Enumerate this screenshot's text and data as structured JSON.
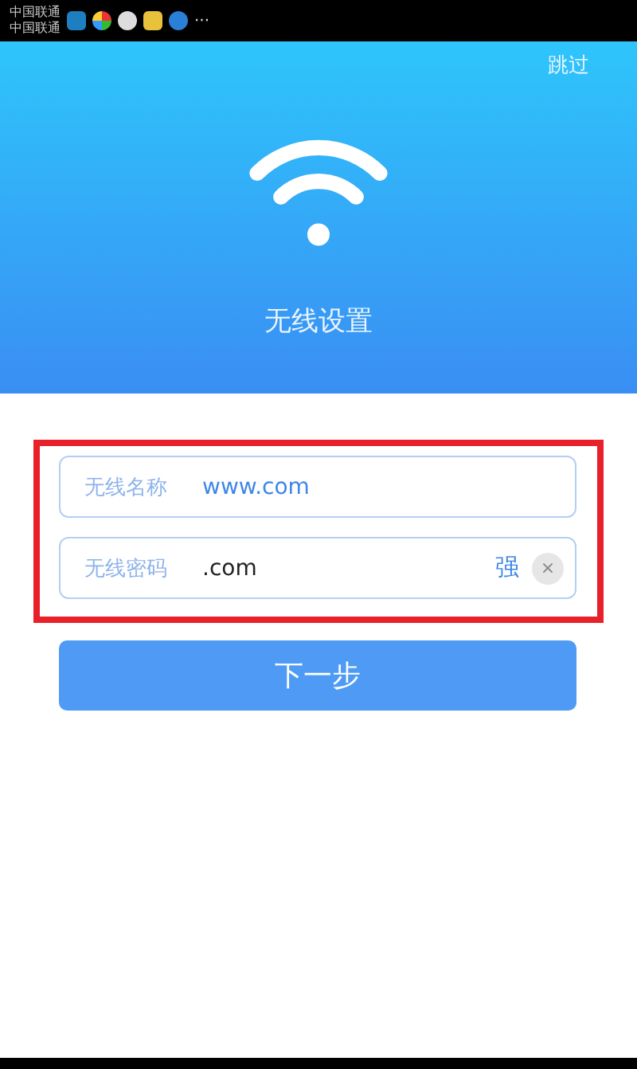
{
  "status_bar": {
    "carriers": [
      "中国联通",
      "中国联通"
    ],
    "more": "···"
  },
  "header": {
    "skip": "跳过",
    "title": "无线设置"
  },
  "fields": [
    {
      "kind": "name",
      "label": "无线名称",
      "value": "www.com"
    },
    {
      "kind": "password",
      "label": "无线密码",
      "value": ".com",
      "strength": "强",
      "clear": "×"
    }
  ],
  "next_button": "下一步"
}
